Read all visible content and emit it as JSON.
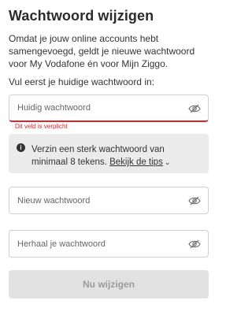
{
  "title": "Wachtwoord wijzigen",
  "intro": "Omdat je jouw online accounts hebt samengevoegd, geldt je nieuwe wachtwoord voor My Vodafone én voor Mijn Ziggo.",
  "prompt": "Vul eerst je huidige wachtwoord in:",
  "current_password": {
    "placeholder": "Huidig wachtwoord",
    "value": "",
    "error": "Dit veld is verplicht"
  },
  "info": {
    "text": "Verzin een sterk wachtwoord van minimaal 8 tekens.",
    "link": "Bekijk de tips"
  },
  "new_password": {
    "placeholder": "Nieuw wachtwoord",
    "value": ""
  },
  "repeat_password": {
    "placeholder": "Herhaal je wachtwoord",
    "value": ""
  },
  "submit_label": "Nu wijzigen",
  "colors": {
    "error": "#d9262b",
    "info_bg": "#ebebeb",
    "button_disabled_bg": "#e2e2e2",
    "button_disabled_text": "#9c9c9c"
  },
  "icons": {
    "password_toggle": "eye-slash-icon",
    "info": "info-icon",
    "link_chevron": "chevron-down-icon"
  }
}
